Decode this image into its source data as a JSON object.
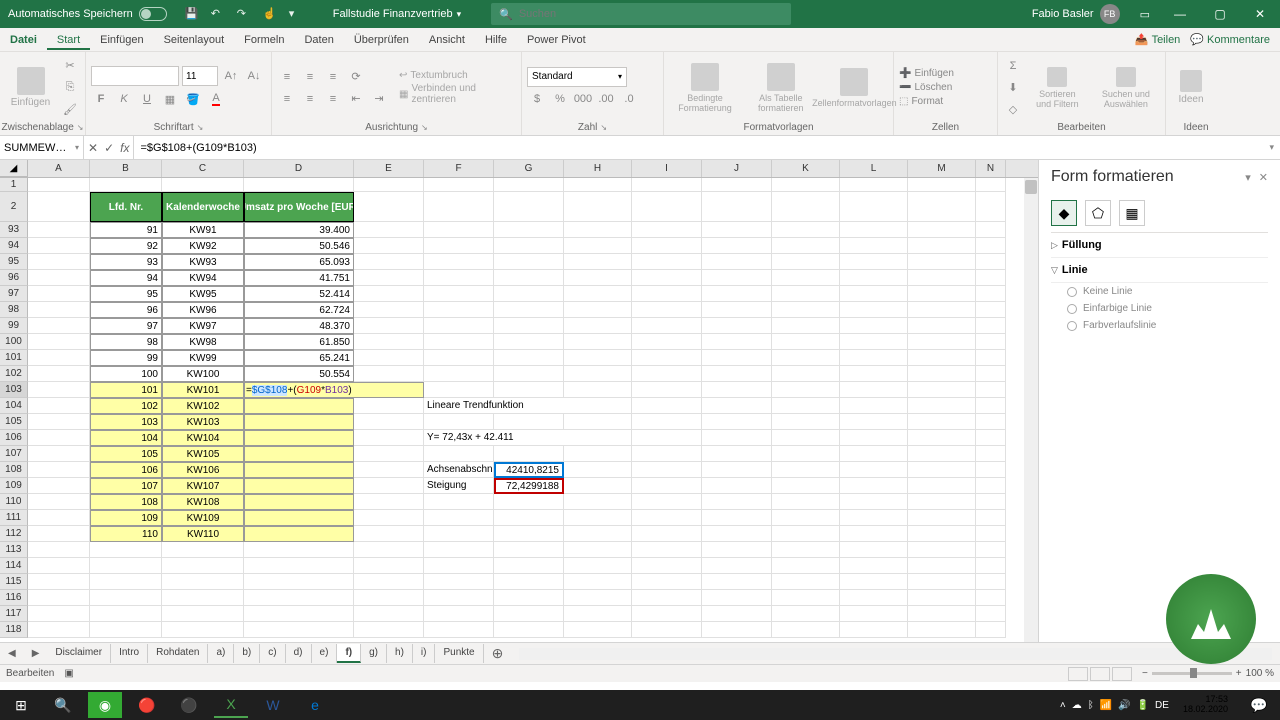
{
  "titlebar": {
    "autosave_label": "Automatisches Speichern",
    "doc_title": "Fallstudie Finanzvertrieb",
    "search_placeholder": "Suchen",
    "user_name": "Fabio Basler",
    "user_initials": "FB"
  },
  "ribbon_tabs": {
    "file": "Datei",
    "tabs": [
      "Start",
      "Einfügen",
      "Seitenlayout",
      "Formeln",
      "Daten",
      "Überprüfen",
      "Ansicht",
      "Hilfe",
      "Power Pivot"
    ],
    "active_index": 0,
    "share": "Teilen",
    "comments": "Kommentare"
  },
  "ribbon": {
    "clipboard": {
      "paste": "Einfügen",
      "label": "Zwischenablage"
    },
    "font": {
      "size": "11",
      "label": "Schriftart"
    },
    "align": {
      "wrap": "Textumbruch",
      "merge": "Verbinden und zentrieren",
      "label": "Ausrichtung"
    },
    "number": {
      "format": "Standard",
      "label": "Zahl"
    },
    "styles": {
      "cond": "Bedingte Formatierung",
      "table": "Als Tabelle formatieren",
      "cell": "Zellenformatvorlagen",
      "label": "Formatvorlagen"
    },
    "cells": {
      "insert": "Einfügen",
      "delete": "Löschen",
      "format": "Format",
      "label": "Zellen"
    },
    "editing": {
      "sort": "Sortieren und Filtern",
      "find": "Suchen und Auswählen",
      "label": "Bearbeiten"
    },
    "ideas": {
      "btn": "Ideen",
      "label": "Ideen"
    }
  },
  "formula_bar": {
    "name_box": "SUMMEW…",
    "formula": "=$G$108+(G109*B103)"
  },
  "columns": [
    "A",
    "B",
    "C",
    "D",
    "E",
    "F",
    "G",
    "H",
    "I",
    "J",
    "K",
    "L",
    "M",
    "N"
  ],
  "sheet": {
    "header_row_num": "2",
    "headers": {
      "b": "Lfd. Nr.",
      "c": "Kalenderwoche",
      "d": "Umsatz pro Woche [EUR]"
    },
    "data_rows": [
      {
        "num": "93",
        "b": "91",
        "c": "KW91",
        "d": "39.400"
      },
      {
        "num": "94",
        "b": "92",
        "c": "KW92",
        "d": "50.546"
      },
      {
        "num": "95",
        "b": "93",
        "c": "KW93",
        "d": "65.093"
      },
      {
        "num": "96",
        "b": "94",
        "c": "KW94",
        "d": "41.751"
      },
      {
        "num": "97",
        "b": "95",
        "c": "KW95",
        "d": "52.414"
      },
      {
        "num": "98",
        "b": "96",
        "c": "KW96",
        "d": "62.724"
      },
      {
        "num": "99",
        "b": "97",
        "c": "KW97",
        "d": "48.370"
      },
      {
        "num": "100",
        "b": "98",
        "c": "KW98",
        "d": "61.850"
      },
      {
        "num": "101",
        "b": "99",
        "c": "KW99",
        "d": "65.241"
      },
      {
        "num": "102",
        "b": "100",
        "c": "KW100",
        "d": "50.554"
      }
    ],
    "yellow_rows": [
      {
        "num": "103",
        "b": "101",
        "c": "KW101"
      },
      {
        "num": "104",
        "b": "102",
        "c": "KW102"
      },
      {
        "num": "105",
        "b": "103",
        "c": "KW103"
      },
      {
        "num": "106",
        "b": "104",
        "c": "KW104"
      },
      {
        "num": "107",
        "b": "105",
        "c": "KW105"
      },
      {
        "num": "108",
        "b": "106",
        "c": "KW106"
      },
      {
        "num": "109",
        "b": "107",
        "c": "KW107"
      },
      {
        "num": "110",
        "b": "108",
        "c": "KW108"
      },
      {
        "num": "111",
        "b": "109",
        "c": "KW109"
      },
      {
        "num": "112",
        "b": "110",
        "c": "KW110"
      }
    ],
    "active_formula": {
      "prefix": "=",
      "part1": "$G$108",
      "plus": "+(",
      "part2": "G109",
      "star": "*",
      "part3": "B103",
      "suffix": ")"
    },
    "extra_rows": [
      "113",
      "114",
      "115",
      "116",
      "117",
      "118"
    ],
    "side_text": {
      "row104": "Lineare Trendfunktion",
      "row106": "Y= 72,43x + 42.411",
      "row108_label": "Achsenabschn",
      "row108_val": "42410,8215",
      "row109_label": "Steigung",
      "row109_val": "72,4299188"
    }
  },
  "right_pane": {
    "title": "Form formatieren",
    "sections": {
      "fill": "Füllung",
      "line": "Linie"
    },
    "line_options": [
      "Keine Linie",
      "Einfarbige Linie",
      "Farbverlaufslinie"
    ]
  },
  "sheet_tabs": {
    "tabs": [
      "Disclaimer",
      "Intro",
      "Rohdaten",
      "a)",
      "b)",
      "c)",
      "d)",
      "e)",
      "f)",
      "g)",
      "h)",
      "i)",
      "Punkte"
    ],
    "active_index": 8
  },
  "status_bar": {
    "mode": "Bearbeiten",
    "zoom": "100 %"
  },
  "taskbar": {
    "time": "17:53",
    "date": "18.02.2020"
  }
}
